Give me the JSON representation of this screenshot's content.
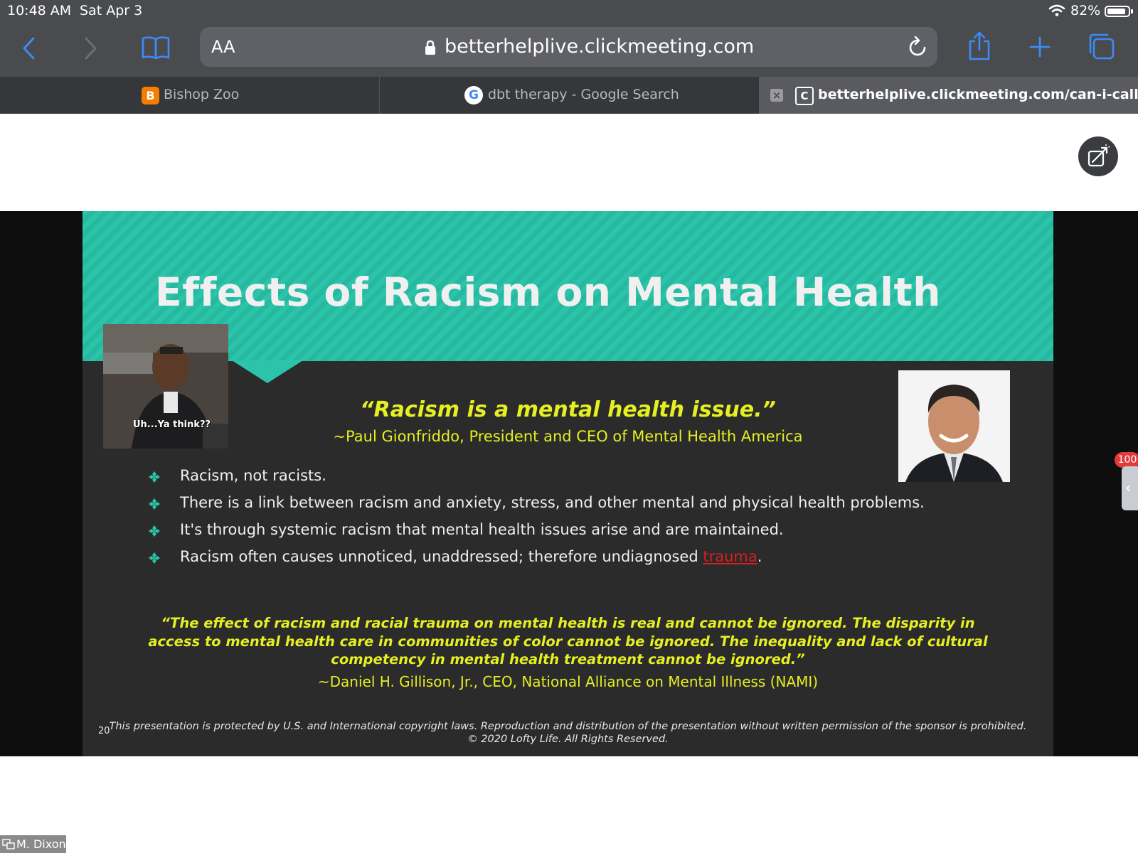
{
  "status": {
    "time": "10:48 AM",
    "date": "Sat Apr 3",
    "battery_percent": "82%",
    "icons": [
      "wifi-icon",
      "battery-icon"
    ]
  },
  "toolbar": {
    "text_size_label": "AA",
    "url": "betterhelplive.clickmeeting.com",
    "icons": [
      "back-icon",
      "forward-icon",
      "bookmarks-icon",
      "lock-icon",
      "reload-icon",
      "share-icon",
      "new-tab-icon",
      "tabs-icon"
    ],
    "accent_color": "#3b8cf7"
  },
  "tabs": [
    {
      "label": "Bishop Zoo",
      "favicon": "blogger-icon",
      "active": false
    },
    {
      "label": "dbt therapy - Google Search",
      "favicon": "google-icon",
      "active": false
    },
    {
      "label": "betterhelplive.clickmeeting.com/can-i-call-i...",
      "favicon": "clickmeeting-icon",
      "active": true
    }
  ],
  "slide": {
    "title": "Effects of Racism on Mental Health",
    "meme_caption": "Uh...Ya think??",
    "quote1": "“Racism is a mental health issue.”",
    "attribution1": "~Paul Gionfriddo, President and CEO of Mental Health America",
    "bullets": [
      "Racism, not racists.",
      "There is a link between racism and anxiety, stress, and other mental and physical health problems.",
      "It's through systemic racism that mental health issues arise and are maintained.",
      "Racism often causes unnoticed, unaddressed; therefore undiagnosed "
    ],
    "bullet4_link": "trauma",
    "bullet4_end": ".",
    "quote2": "“The effect of racism and racial trauma on mental health is real and cannot be ignored. The disparity in access to mental health care in communities of color cannot be ignored. The inequality and lack of cultural competency in mental health treatment cannot be ignored.”",
    "attribution2": "~Daniel H. Gillison, Jr., CEO, National Alliance on Mental Illness (NAMI)",
    "copyright_line1": "This presentation is protected by U.S. and International copyright laws. Reproduction and distribution of the presentation without written permission of the sponsor is prohibited.",
    "copyright_line2": "© 2020 Lofty Life. All Rights Reserved.",
    "slide_number": "20",
    "colors": {
      "banner": "#2bc4aa",
      "quote": "#e5ef22",
      "background": "#2b2b2b",
      "link": "#d81f1f"
    }
  },
  "side_panel": {
    "badge_count": "100",
    "toggle_icon": "chevron-left-icon"
  },
  "presenter": {
    "name": "M. Dixon",
    "icon": "screen-share-icon"
  },
  "expand_button_icon": "expand-icon"
}
